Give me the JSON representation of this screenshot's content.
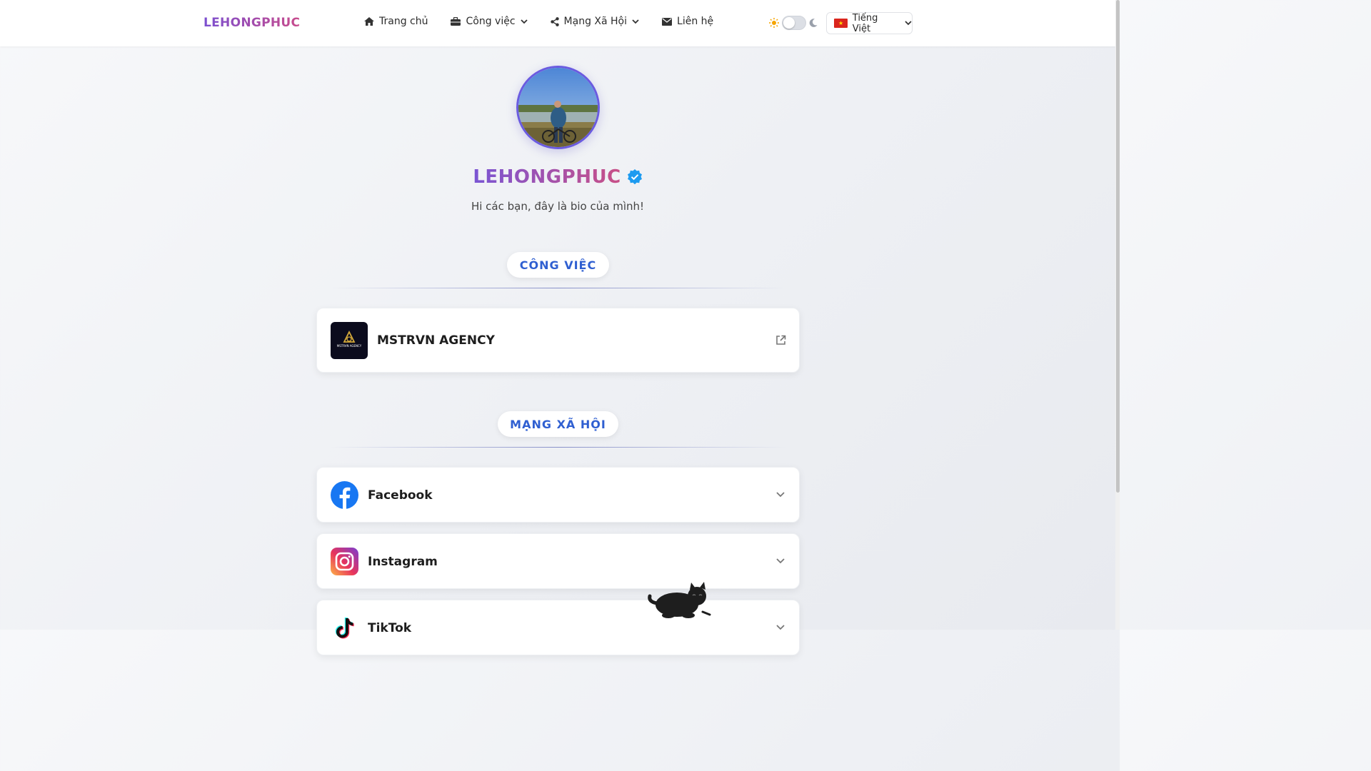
{
  "header": {
    "brand": "LEHONGPHUC",
    "nav": [
      {
        "label": "Trang chủ",
        "icon": "home-icon"
      },
      {
        "label": "Công việc",
        "icon": "briefcase-icon",
        "dropdown": true
      },
      {
        "label": "Mạng Xã Hội",
        "icon": "share-icon",
        "dropdown": true
      },
      {
        "label": "Liên hệ",
        "icon": "envelope-icon"
      }
    ],
    "theme": {
      "light_icon": "sun-icon",
      "dark_icon": "moon-icon",
      "dark_mode": false
    },
    "language": {
      "label": "Tiếng Việt",
      "flag": "vietnam-flag"
    }
  },
  "profile": {
    "name": "LEHONGPHUC",
    "verified": true,
    "bio": "Hi các bạn, đây là bio của mình!"
  },
  "sections": {
    "work": {
      "title": "CÔNG VIỆC",
      "items": [
        {
          "label": "MSTRVN AGENCY",
          "logo_text": "MSTRVN AGENCY",
          "icon": "external-link-icon"
        }
      ]
    },
    "social": {
      "title": "MẠNG XÃ HỘI",
      "items": [
        {
          "label": "Facebook",
          "icon": "facebook-icon"
        },
        {
          "label": "Instagram",
          "icon": "instagram-icon"
        },
        {
          "label": "TikTok",
          "icon": "tiktok-icon"
        }
      ]
    }
  },
  "colors": {
    "accent_blue": "#2f5fd1",
    "brand_gradient_start": "#7a55d4",
    "brand_gradient_end": "#c94f86",
    "verified_blue": "#1d9bf0",
    "facebook_blue": "#1877f2"
  }
}
